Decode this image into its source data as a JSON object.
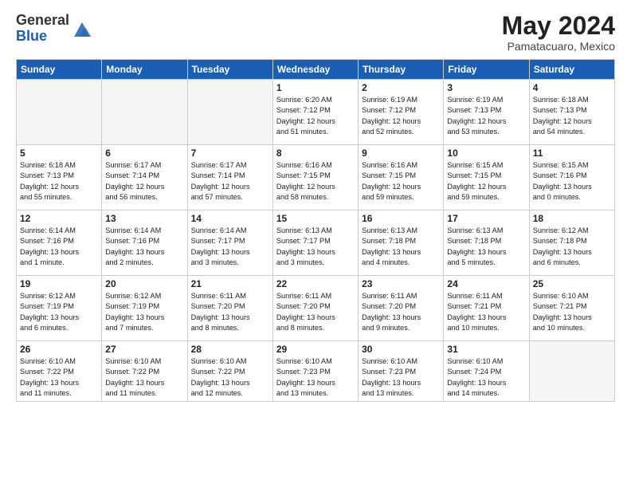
{
  "header": {
    "logo_general": "General",
    "logo_blue": "Blue",
    "title": "May 2024",
    "location": "Pamatacuaro, Mexico"
  },
  "days_of_week": [
    "Sunday",
    "Monday",
    "Tuesday",
    "Wednesday",
    "Thursday",
    "Friday",
    "Saturday"
  ],
  "weeks": [
    [
      {
        "day": "",
        "empty": true
      },
      {
        "day": "",
        "empty": true
      },
      {
        "day": "",
        "empty": true
      },
      {
        "day": "1",
        "lines": [
          "Sunrise: 6:20 AM",
          "Sunset: 7:12 PM",
          "Daylight: 12 hours",
          "and 51 minutes."
        ]
      },
      {
        "day": "2",
        "lines": [
          "Sunrise: 6:19 AM",
          "Sunset: 7:12 PM",
          "Daylight: 12 hours",
          "and 52 minutes."
        ]
      },
      {
        "day": "3",
        "lines": [
          "Sunrise: 6:19 AM",
          "Sunset: 7:13 PM",
          "Daylight: 12 hours",
          "and 53 minutes."
        ]
      },
      {
        "day": "4",
        "lines": [
          "Sunrise: 6:18 AM",
          "Sunset: 7:13 PM",
          "Daylight: 12 hours",
          "and 54 minutes."
        ]
      }
    ],
    [
      {
        "day": "5",
        "lines": [
          "Sunrise: 6:18 AM",
          "Sunset: 7:13 PM",
          "Daylight: 12 hours",
          "and 55 minutes."
        ]
      },
      {
        "day": "6",
        "lines": [
          "Sunrise: 6:17 AM",
          "Sunset: 7:14 PM",
          "Daylight: 12 hours",
          "and 56 minutes."
        ]
      },
      {
        "day": "7",
        "lines": [
          "Sunrise: 6:17 AM",
          "Sunset: 7:14 PM",
          "Daylight: 12 hours",
          "and 57 minutes."
        ]
      },
      {
        "day": "8",
        "lines": [
          "Sunrise: 6:16 AM",
          "Sunset: 7:15 PM",
          "Daylight: 12 hours",
          "and 58 minutes."
        ]
      },
      {
        "day": "9",
        "lines": [
          "Sunrise: 6:16 AM",
          "Sunset: 7:15 PM",
          "Daylight: 12 hours",
          "and 59 minutes."
        ]
      },
      {
        "day": "10",
        "lines": [
          "Sunrise: 6:15 AM",
          "Sunset: 7:15 PM",
          "Daylight: 12 hours",
          "and 59 minutes."
        ]
      },
      {
        "day": "11",
        "lines": [
          "Sunrise: 6:15 AM",
          "Sunset: 7:16 PM",
          "Daylight: 13 hours",
          "and 0 minutes."
        ]
      }
    ],
    [
      {
        "day": "12",
        "lines": [
          "Sunrise: 6:14 AM",
          "Sunset: 7:16 PM",
          "Daylight: 13 hours",
          "and 1 minute."
        ]
      },
      {
        "day": "13",
        "lines": [
          "Sunrise: 6:14 AM",
          "Sunset: 7:16 PM",
          "Daylight: 13 hours",
          "and 2 minutes."
        ]
      },
      {
        "day": "14",
        "lines": [
          "Sunrise: 6:14 AM",
          "Sunset: 7:17 PM",
          "Daylight: 13 hours",
          "and 3 minutes."
        ]
      },
      {
        "day": "15",
        "lines": [
          "Sunrise: 6:13 AM",
          "Sunset: 7:17 PM",
          "Daylight: 13 hours",
          "and 3 minutes."
        ]
      },
      {
        "day": "16",
        "lines": [
          "Sunrise: 6:13 AM",
          "Sunset: 7:18 PM",
          "Daylight: 13 hours",
          "and 4 minutes."
        ]
      },
      {
        "day": "17",
        "lines": [
          "Sunrise: 6:13 AM",
          "Sunset: 7:18 PM",
          "Daylight: 13 hours",
          "and 5 minutes."
        ]
      },
      {
        "day": "18",
        "lines": [
          "Sunrise: 6:12 AM",
          "Sunset: 7:18 PM",
          "Daylight: 13 hours",
          "and 6 minutes."
        ]
      }
    ],
    [
      {
        "day": "19",
        "lines": [
          "Sunrise: 6:12 AM",
          "Sunset: 7:19 PM",
          "Daylight: 13 hours",
          "and 6 minutes."
        ]
      },
      {
        "day": "20",
        "lines": [
          "Sunrise: 6:12 AM",
          "Sunset: 7:19 PM",
          "Daylight: 13 hours",
          "and 7 minutes."
        ]
      },
      {
        "day": "21",
        "lines": [
          "Sunrise: 6:11 AM",
          "Sunset: 7:20 PM",
          "Daylight: 13 hours",
          "and 8 minutes."
        ]
      },
      {
        "day": "22",
        "lines": [
          "Sunrise: 6:11 AM",
          "Sunset: 7:20 PM",
          "Daylight: 13 hours",
          "and 8 minutes."
        ]
      },
      {
        "day": "23",
        "lines": [
          "Sunrise: 6:11 AM",
          "Sunset: 7:20 PM",
          "Daylight: 13 hours",
          "and 9 minutes."
        ]
      },
      {
        "day": "24",
        "lines": [
          "Sunrise: 6:11 AM",
          "Sunset: 7:21 PM",
          "Daylight: 13 hours",
          "and 10 minutes."
        ]
      },
      {
        "day": "25",
        "lines": [
          "Sunrise: 6:10 AM",
          "Sunset: 7:21 PM",
          "Daylight: 13 hours",
          "and 10 minutes."
        ]
      }
    ],
    [
      {
        "day": "26",
        "lines": [
          "Sunrise: 6:10 AM",
          "Sunset: 7:22 PM",
          "Daylight: 13 hours",
          "and 11 minutes."
        ]
      },
      {
        "day": "27",
        "lines": [
          "Sunrise: 6:10 AM",
          "Sunset: 7:22 PM",
          "Daylight: 13 hours",
          "and 11 minutes."
        ]
      },
      {
        "day": "28",
        "lines": [
          "Sunrise: 6:10 AM",
          "Sunset: 7:22 PM",
          "Daylight: 13 hours",
          "and 12 minutes."
        ]
      },
      {
        "day": "29",
        "lines": [
          "Sunrise: 6:10 AM",
          "Sunset: 7:23 PM",
          "Daylight: 13 hours",
          "and 13 minutes."
        ]
      },
      {
        "day": "30",
        "lines": [
          "Sunrise: 6:10 AM",
          "Sunset: 7:23 PM",
          "Daylight: 13 hours",
          "and 13 minutes."
        ]
      },
      {
        "day": "31",
        "lines": [
          "Sunrise: 6:10 AM",
          "Sunset: 7:24 PM",
          "Daylight: 13 hours",
          "and 14 minutes."
        ]
      },
      {
        "day": "",
        "empty": true
      }
    ]
  ]
}
